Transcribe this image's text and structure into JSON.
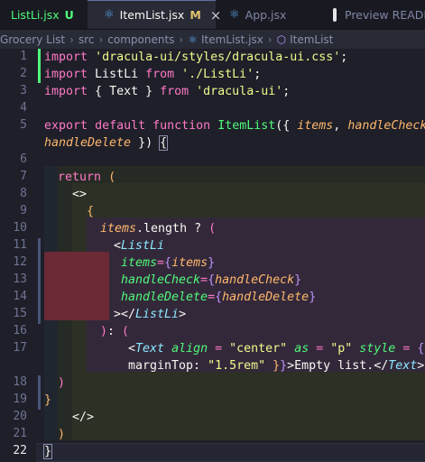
{
  "tabs": [
    {
      "name": "ListLi.jsx",
      "status": "U",
      "icon": "react-icon"
    },
    {
      "name": "ItemList.jsx",
      "status": "M",
      "icon": "react-icon",
      "close": "×"
    },
    {
      "name": "App.jsx",
      "status": "",
      "icon": "react-icon"
    },
    {
      "name": "Preview README",
      "status": "",
      "icon": "preview-icon"
    }
  ],
  "breadcrumb": [
    "Grocery List",
    "src",
    "components",
    "ItemList.jsx",
    "ItemList"
  ],
  "line_numbers": [
    "1",
    "2",
    "3",
    "4",
    "5",
    "",
    "6",
    "7",
    "8",
    "9",
    "10",
    "11",
    "12",
    "13",
    "14",
    "15",
    "16",
    "17",
    "",
    "18",
    "19",
    "20",
    "21",
    "22"
  ],
  "code": {
    "l1_kw": "import",
    "l1_str": "'dracula-ui/styles/dracula-ui.css'",
    "l1_end": ";",
    "l2_kw": "import",
    "l2_id": " ListLi ",
    "l2_from": "from",
    "l2_str": "'./ListLi'",
    "l2_end": ";",
    "l3_kw": "import",
    "l3_id": " { Text } ",
    "l3_from": "from",
    "l3_str": "'dracula-ui'",
    "l3_end": ";",
    "l5_export": "export",
    "l5_default": "default",
    "l5_function": "function",
    "l5_name": "ItemList",
    "l5_paren": "({ ",
    "l5_items": "items",
    "l5_comma": ", ",
    "l5_hc": "handleCheck",
    "l5_comma2": ",",
    "l5w_hd": "handleDelete",
    "l5w_close": " }) ",
    "l5w_brace": "{",
    "l7_return": "return",
    "l7_paren": "(",
    "l8_frag": "<>",
    "l9_brace": "{",
    "l10_items": "items",
    "l10_rest": ".length ? ",
    "l10_paren": "(",
    "l11_lt": "<",
    "l11_tag": "ListLi",
    "l12_attr": "items",
    "l12_eq": "=",
    "l12_ob": "{",
    "l12_val": "items",
    "l12_cb": "}",
    "l13_attr": "handleCheck",
    "l13_eq": "=",
    "l13_ob": "{",
    "l13_val": "handleCheck",
    "l13_cb": "}",
    "l14_attr": "handleDelete",
    "l14_eq": "=",
    "l14_ob": "{",
    "l14_val": "handleDelete",
    "l14_cb": "}",
    "l15_close": "></",
    "l15_tag": "ListLi",
    "l15_gt": ">",
    "l16_paren": ")",
    "l16_rest": ": ",
    "l16_paren2": "(",
    "l17_lt": "<",
    "l17_tag": "Text",
    "l17_align": "align",
    "l17_eq1": " = ",
    "l17_center": "\"center\"",
    "l17_as": "as",
    "l17_eq2": " = ",
    "l17_p": "\"p\"",
    "l17_style": "style",
    "l17_eq3": " = ",
    "l17_ob": "{",
    "l17_ob2": "{",
    "l17w_mt": "marginTop: ",
    "l17w_val": "\"1.5rem\"",
    "l17w_cb": " }",
    "l17w_cb2": "}",
    "l17w_text": ">Empty list.</",
    "l17w_tag": "Text",
    "l17w_gt": ">",
    "l18_paren": ")",
    "l19_brace": "}",
    "l20_frag": "</>",
    "l21_paren": ")",
    "l22_brace": "}"
  },
  "colors": {
    "background": "#1e1f29",
    "keyword": "#ff79c6",
    "string": "#f1fa8c",
    "function": "#50fa7b",
    "param": "#ffb86c",
    "component": "#8be9fd",
    "git_added": "#50fa7b",
    "git_modified": "#6272a4",
    "diff_removed_band": "#6b2a35"
  }
}
